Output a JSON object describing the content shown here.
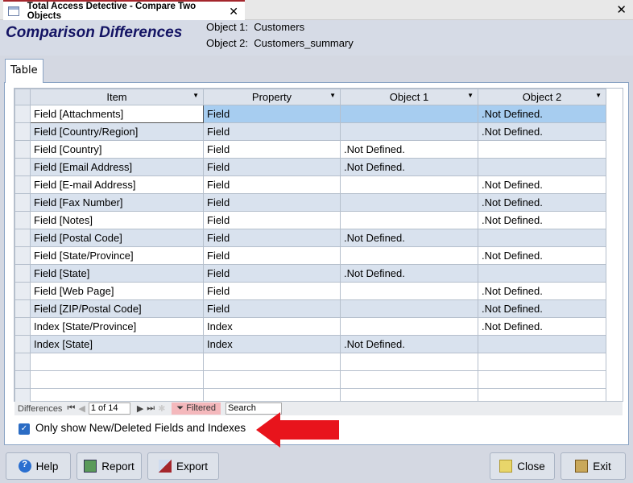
{
  "window": {
    "tab_title": "Total Access Detective - Compare Two Objects",
    "close": "✕"
  },
  "header": {
    "title": "Comparison Differences",
    "object1_label": "Object 1:",
    "object1": "Customers",
    "object2_label": "Object 2:",
    "object2": "Customers_summary"
  },
  "tab": "Table",
  "grid": {
    "columns": [
      "Item",
      "Property",
      "Object 1",
      "Object 2"
    ],
    "rows": [
      [
        "Field [Attachments]",
        "Field",
        "",
        ".Not Defined."
      ],
      [
        "Field [Country/Region]",
        "Field",
        "",
        ".Not Defined."
      ],
      [
        "Field [Country]",
        "Field",
        ".Not Defined.",
        ""
      ],
      [
        "Field [Email Address]",
        "Field",
        ".Not Defined.",
        ""
      ],
      [
        "Field [E-mail Address]",
        "Field",
        "",
        ".Not Defined."
      ],
      [
        "Field [Fax Number]",
        "Field",
        "",
        ".Not Defined."
      ],
      [
        "Field [Notes]",
        "Field",
        "",
        ".Not Defined."
      ],
      [
        "Field [Postal Code]",
        "Field",
        ".Not Defined.",
        ""
      ],
      [
        "Field [State/Province]",
        "Field",
        "",
        ".Not Defined."
      ],
      [
        "Field [State]",
        "Field",
        ".Not Defined.",
        ""
      ],
      [
        "Field [Web Page]",
        "Field",
        "",
        ".Not Defined."
      ],
      [
        "Field [ZIP/Postal Code]",
        "Field",
        "",
        ".Not Defined."
      ],
      [
        "Index [State/Province]",
        "Index",
        "",
        ".Not Defined."
      ],
      [
        "Index [State]",
        "Index",
        ".Not Defined.",
        ""
      ]
    ]
  },
  "navigation": {
    "label": "Differences",
    "record": "1 of 14",
    "filter": "Filtered",
    "search": "Search"
  },
  "option": {
    "label": "Only show New/Deleted Fields and Indexes",
    "checked": true
  },
  "buttons": {
    "help": "Help",
    "report": "Report",
    "export": "Export",
    "close": "Close",
    "exit": "Exit"
  },
  "colors": {
    "title": "#141464",
    "selected": "#a7cdf0",
    "alt_row": "#d9e2ee",
    "arrow": "#e8141c",
    "checkbox": "#2b6cc4"
  }
}
